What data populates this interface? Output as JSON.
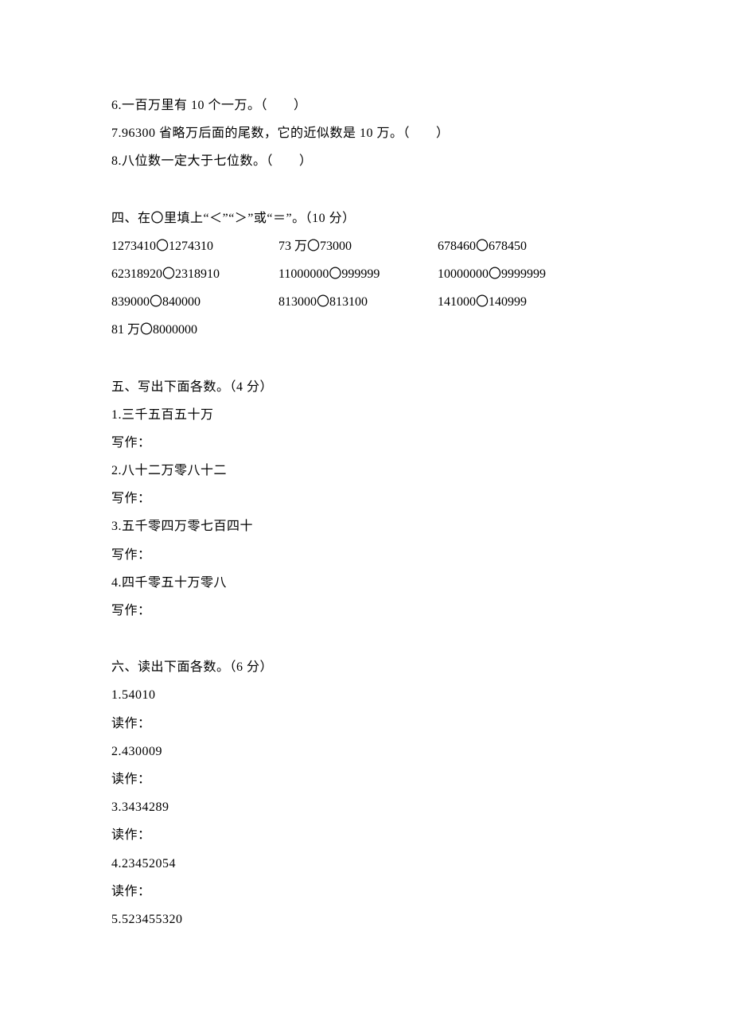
{
  "judge": {
    "q6": "6.一百万里有 10 个一万。（　　）",
    "q7": "7.96300 省略万后面的尾数，它的近似数是 10 万。（　　）",
    "q8": "8.八位数一定大于七位数。（　　）"
  },
  "section4": {
    "title": "四、在〇里填上“＜”“＞”或“＝”。（10 分）",
    "rows": [
      [
        "1273410〇1274310",
        "73 万〇73000",
        "678460〇678450"
      ],
      [
        "62318920〇2318910",
        "11000000〇999999",
        "10000000〇9999999"
      ],
      [
        "839000〇840000",
        "813000〇813100",
        "141000〇140999"
      ],
      [
        "81 万〇8000000",
        "",
        ""
      ]
    ]
  },
  "section5": {
    "title": "五、写出下面各数。（4 分）",
    "items": [
      {
        "q": "1.三千五百五十万",
        "label": "写作："
      },
      {
        "q": "2.八十二万零八十二",
        "label": "写作："
      },
      {
        "q": "3.五千零四万零七百四十",
        "label": "写作："
      },
      {
        "q": "4.四千零五十万零八",
        "label": "写作："
      }
    ]
  },
  "section6": {
    "title": "六、读出下面各数。（6 分）",
    "items": [
      {
        "q": "1.54010",
        "label": "读作："
      },
      {
        "q": "2.430009",
        "label": "读作："
      },
      {
        "q": "3.3434289",
        "label": "读作："
      },
      {
        "q": "4.23452054",
        "label": "读作："
      },
      {
        "q": "5.523455320",
        "label": ""
      }
    ]
  }
}
